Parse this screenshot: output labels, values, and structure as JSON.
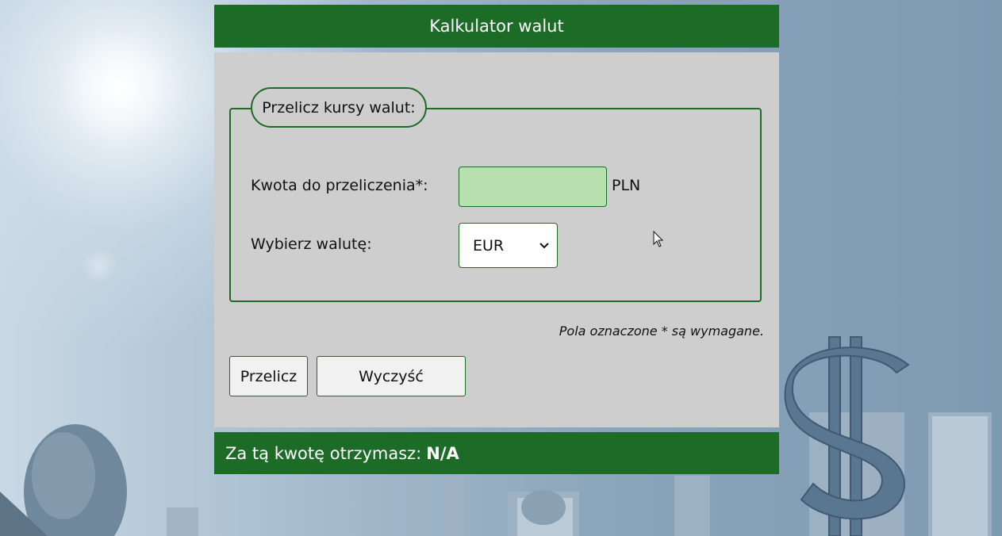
{
  "header": {
    "title": "Kalkulator walut"
  },
  "form": {
    "legend": "Przelicz kursy walut:",
    "amount_label": "Kwota do przeliczenia*:",
    "amount_value": "",
    "amount_unit": "PLN",
    "currency_label": "Wybierz walutę:",
    "currency_selected": "EUR",
    "required_note": "Pola oznaczone * są wymagane."
  },
  "buttons": {
    "calculate": "Przelicz",
    "clear": "Wyczyść"
  },
  "result": {
    "label": "Za tą kwotę otrzymasz:",
    "value": "N/A"
  },
  "colors": {
    "accent": "#1c6b26",
    "panel": "#cdcecd",
    "input_bg": "#b8dfae"
  }
}
